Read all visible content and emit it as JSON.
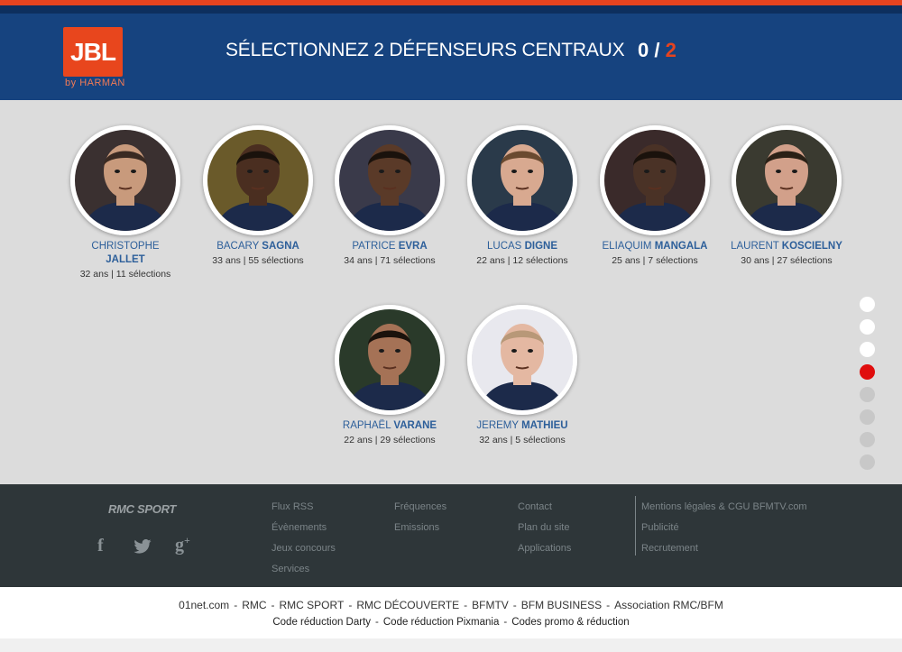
{
  "header": {
    "logo_text": "JBL",
    "logo_sub": "HARMAN",
    "title": "SÉLECTIONNEZ 2 DÉFENSEURS CENTRAUX",
    "count_selected": "0",
    "count_sep": " / ",
    "count_total": "2",
    "colors": {
      "header_bg": "#16437f",
      "accent": "#e5431f"
    }
  },
  "players": [
    {
      "first": "CHRISTOPHE",
      "last": "JALLET",
      "stats": "32 ans | 11 sélections"
    },
    {
      "first": "BACARY",
      "last": "SAGNA",
      "stats": "33 ans | 55 sélections"
    },
    {
      "first": "PATRICE",
      "last": "EVRA",
      "stats": "34 ans | 71 sélections"
    },
    {
      "first": "LUCAS",
      "last": "DIGNE",
      "stats": "22 ans | 12 sélections"
    },
    {
      "first": "ELIAQUIM",
      "last": "MANGALA",
      "stats": "25 ans | 7 sélections"
    },
    {
      "first": "LAURENT",
      "last": "KOSCIELNY",
      "stats": "30 ans | 27 sélections"
    },
    {
      "first": "RAPHAËL",
      "last": "VARANE",
      "stats": "22 ans | 29 sélections"
    },
    {
      "first": "JEREMY",
      "last": "MATHIEU",
      "stats": "32 ans | 5 sélections"
    }
  ],
  "progress": {
    "steps": 8,
    "current": 4
  },
  "footer": {
    "brand": "RMC SPORT",
    "social_icons": [
      "facebook-icon",
      "twitter-icon",
      "google-plus-icon"
    ],
    "col1": [
      "Flux RSS",
      "Évènements",
      "Jeux concours",
      "Services"
    ],
    "col2": [
      "Fréquences",
      "Emissions"
    ],
    "col3": [
      "Contact",
      "Plan du site",
      "Applications"
    ],
    "col4": [
      "Mentions légales & CGU BFMTV.com",
      "Publicité",
      "Recrutement"
    ]
  },
  "bottom": {
    "row1": [
      "01net.com",
      "RMC",
      "RMC SPORT",
      "RMC DÉCOUVERTE",
      "BFMTV",
      "BFM BUSINESS",
      "Association RMC/BFM"
    ],
    "row2": [
      "Code réduction Darty",
      "Code réduction Pixmania",
      "Codes promo & réduction"
    ]
  }
}
